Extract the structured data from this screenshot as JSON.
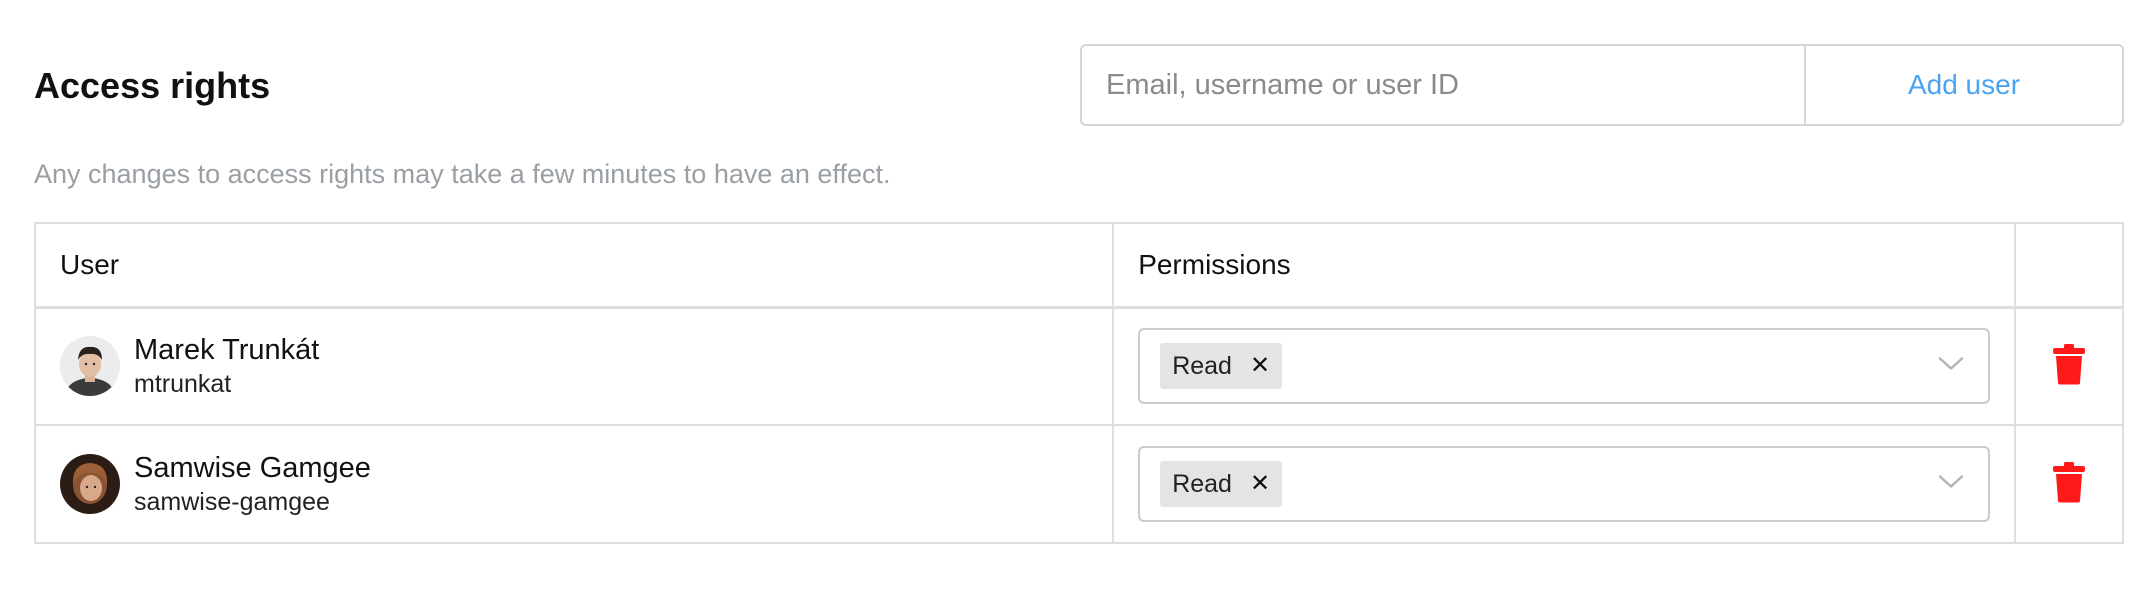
{
  "header": {
    "title": "Access rights",
    "subtitle": "Any changes to access rights may take a few minutes to have an effect."
  },
  "add_user": {
    "placeholder": "Email, username or user ID",
    "value": "",
    "button_label": "Add user"
  },
  "table": {
    "columns": [
      "User",
      "Permissions",
      ""
    ],
    "rows": [
      {
        "name": "Marek Trunkát",
        "username": "mtrunkat",
        "permissions": [
          {
            "label": "Read",
            "remove_icon": "x-icon"
          }
        ],
        "avatar_icon": "avatar-icon",
        "delete_icon": "trash-icon"
      },
      {
        "name": "Samwise Gamgee",
        "username": "samwise-gamgee",
        "permissions": [
          {
            "label": "Read",
            "remove_icon": "x-icon"
          }
        ],
        "avatar_icon": "avatar-icon",
        "delete_icon": "trash-icon"
      }
    ]
  },
  "colors": {
    "accent": "#4aa3f0",
    "delete": "#ff1a1a",
    "border": "#dedede",
    "muted_text": "#9a9fa4",
    "tag_bg": "#e4e4e4"
  }
}
